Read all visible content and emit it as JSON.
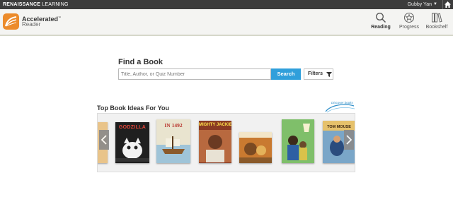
{
  "topbar": {
    "brand_bold": "RENAISSANCE",
    "brand_rest": " LEARNING",
    "user_name": "Gubby Yan"
  },
  "app": {
    "title": "Accelerated",
    "title_mark": "™",
    "subtitle": "Reader"
  },
  "nav": [
    {
      "label": "Reading",
      "icon": "search-icon",
      "active": true
    },
    {
      "label": "Progress",
      "icon": "star-badge-icon",
      "active": false
    },
    {
      "label": "Bookshelf",
      "icon": "bookshelf-icon",
      "active": false
    }
  ],
  "find": {
    "title": "Find a Book",
    "placeholder": "Title, Author, or Quiz Number",
    "value": "",
    "search_label": "Search",
    "filters_label": "Filters"
  },
  "ideas": {
    "title": "Top Book Ideas For You",
    "badge_text": "Discover books",
    "books": [
      {
        "cover_text": "",
        "color": "#e9c48a"
      },
      {
        "cover_text": "GODZILLA",
        "color": "#1f1f1f"
      },
      {
        "cover_text": "IN 1492",
        "color": "#e9e4cf"
      },
      {
        "cover_text": "MIGHTY JACKIE",
        "color": "#8a3a23"
      },
      {
        "cover_text": "",
        "color": "#c97a30"
      },
      {
        "cover_text": "",
        "color": "#5aa35a"
      },
      {
        "cover_text": "TOM MOUSE",
        "color": "#e6c16b"
      },
      {
        "cover_text": "",
        "color": "#2b4c7e"
      }
    ]
  },
  "colors": {
    "accent": "#2f9fdb",
    "logo": "#ec8b2b",
    "topbar": "#3c3c3c"
  }
}
